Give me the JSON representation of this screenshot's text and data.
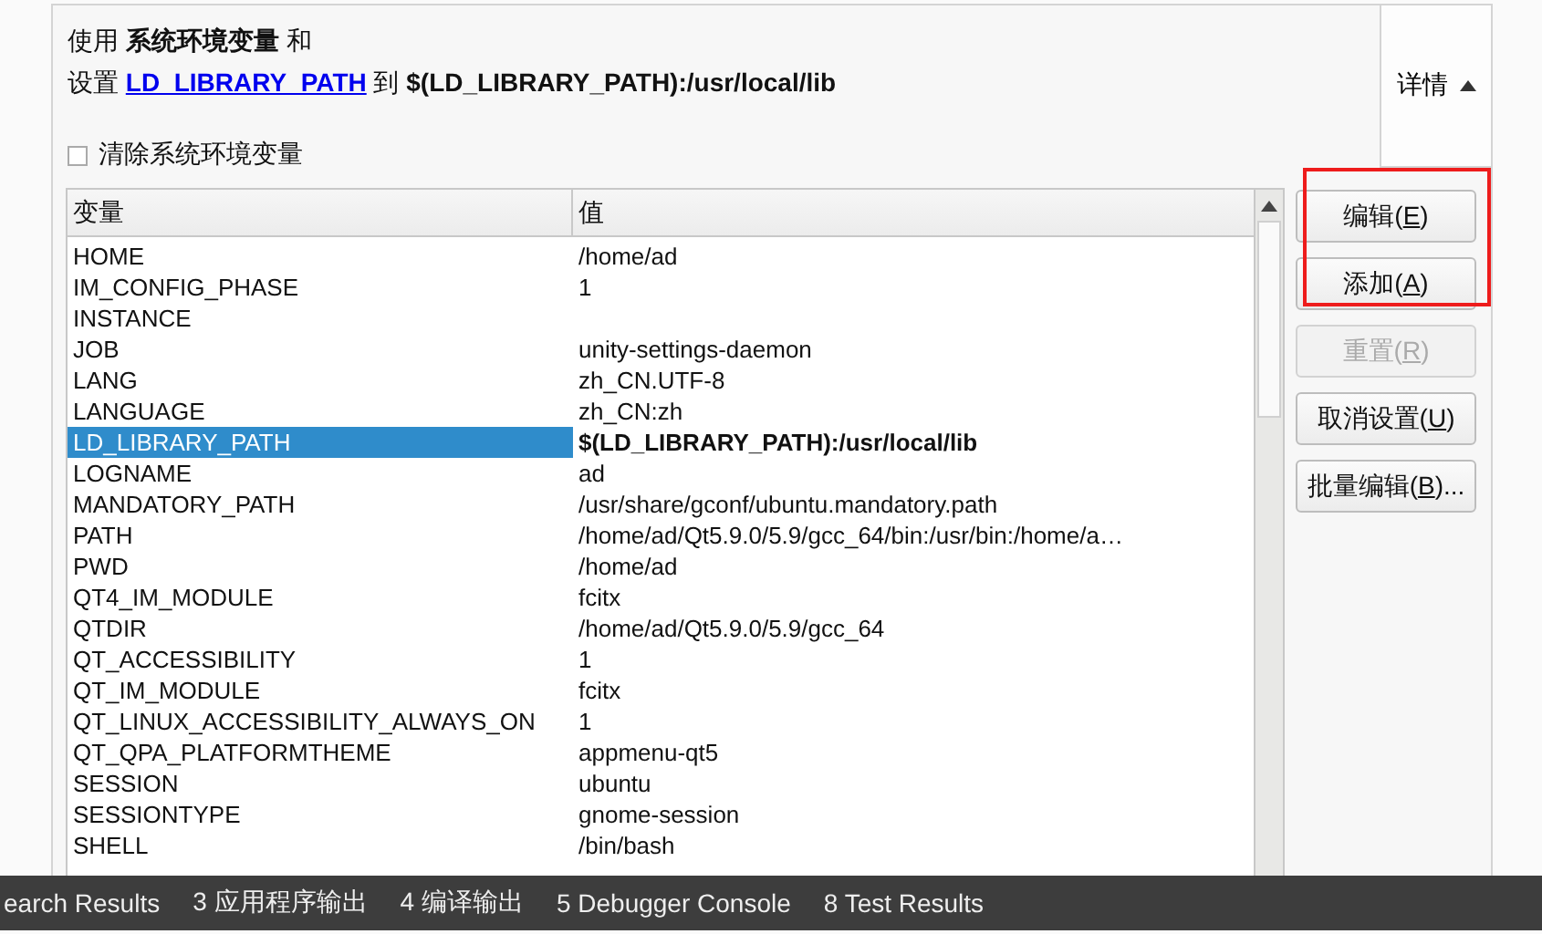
{
  "summary": {
    "line_1": "使用 **系统环境变量** 和",
    "line_2": {
      "prefix": "设置 ",
      "link": "LD_LIBRARY_PATH",
      "suffix": " 到 **$(LD_LIBRARY_PATH):/usr/local/lib**"
    }
  },
  "details_button": {
    "label": "详情",
    "expanded": true
  },
  "clear_checkbox": {
    "label": "清除系统环境变量",
    "checked": false
  },
  "table": {
    "columns": [
      "变量",
      "值"
    ],
    "rows": [
      {
        "name": "HOME",
        "value": "/home/ad",
        "selected": false,
        "kind": "system"
      },
      {
        "name": "IM_CONFIG_PHASE",
        "value": "1",
        "selected": false,
        "kind": "system"
      },
      {
        "name": "INSTANCE",
        "selected": false,
        "kind": "system"
      },
      {
        "name": "JOB",
        "value": "unity-settings-daemon",
        "selected": false,
        "kind": "system"
      },
      {
        "name": "LANG",
        "value": "zh_CN.UTF-8",
        "selected": false,
        "kind": "system"
      },
      {
        "name": "LANGUAGE",
        "value": "zh_CN:zh",
        "selected": false,
        "kind": "system"
      },
      {
        "name": "LD_LIBRARY_PATH",
        "value": "$(LD_LIBRARY_PATH):/usr/local/lib",
        "selected": true,
        "kind": "changed"
      },
      {
        "name": "LOGNAME",
        "value": "ad",
        "selected": false,
        "kind": "system"
      },
      {
        "name": "MANDATORY_PATH",
        "value": "/usr/share/gconf/ubuntu.mandatory.path",
        "selected": false,
        "kind": "system"
      },
      {
        "name": "PATH",
        "value": "/home/ad/Qt5.9.0/5.9/gcc_64/bin:/usr/bin:/home/a…",
        "selected": false,
        "kind": "system"
      },
      {
        "name": "PWD",
        "value": "/home/ad",
        "selected": false,
        "kind": "system"
      },
      {
        "name": "QT4_IM_MODULE",
        "value": "fcitx",
        "selected": false,
        "kind": "system"
      },
      {
        "name": "QTDIR",
        "value": "/home/ad/Qt5.9.0/5.9/gcc_64",
        "selected": false,
        "kind": "system"
      },
      {
        "name": "QT_ACCESSIBILITY",
        "value": "1",
        "selected": false,
        "kind": "system"
      },
      {
        "name": "QT_IM_MODULE",
        "value": "fcitx",
        "selected": false,
        "kind": "system"
      },
      {
        "name": "QT_LINUX_ACCESSIBILITY_ALWAYS_ON",
        "value": "1",
        "selected": false,
        "kind": "system"
      },
      {
        "name": "QT_QPA_PLATFORMTHEME",
        "value": "appmenu-qt5",
        "selected": false,
        "kind": "system"
      },
      {
        "name": "SESSION",
        "value": "ubuntu",
        "selected": false,
        "kind": "system"
      },
      {
        "name": "SESSIONTYPE",
        "value": "gnome-session",
        "selected": false,
        "kind": "system"
      },
      {
        "name": "SHELL",
        "value": "/bin/bash",
        "selected": false,
        "kind": "system"
      }
    ]
  },
  "buttons": [
    {
      "before": "编辑(",
      "key": "E",
      "after": ")",
      "disabled": false
    },
    {
      "before": "添加(",
      "key": "A",
      "after": ")",
      "disabled": false
    },
    {
      "before": "重置(",
      "key": "R",
      "after": ")",
      "disabled": true
    },
    {
      "before": "取消设置(",
      "key": "U",
      "after": ")",
      "disabled": false
    },
    {
      "before": "批量编辑(",
      "key": "B",
      "after": ")...",
      "disabled": false
    }
  ],
  "output_tabs": [
    "earch Results",
    "3 应用程序输出",
    "4 编译输出",
    "5 Debugger Console",
    "8 Test Results"
  ]
}
